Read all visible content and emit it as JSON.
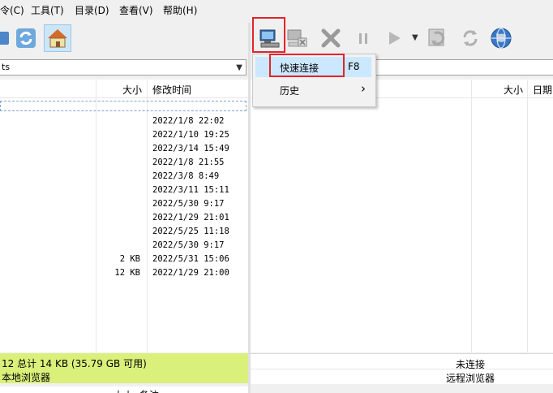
{
  "menu": {
    "items": [
      "令(C)",
      "工具(T)",
      "目录(D)",
      "查看(V)",
      "帮助(H)"
    ]
  },
  "left_pane": {
    "path_value": "ts",
    "columns": {
      "size": "大小",
      "modified": "修改时间"
    },
    "rows": [
      {
        "size": "",
        "modified": ""
      },
      {
        "size": "",
        "modified": "2022/1/8 22:02"
      },
      {
        "size": "",
        "modified": "2022/1/10 19:25"
      },
      {
        "size": "",
        "modified": "2022/3/14 15:49"
      },
      {
        "size": "",
        "modified": "2022/1/8 21:55"
      },
      {
        "size": "",
        "modified": "2022/3/8 8:49"
      },
      {
        "size": "",
        "modified": "2022/3/11 15:11"
      },
      {
        "size": "",
        "modified": "2022/5/30 9:17"
      },
      {
        "size": "",
        "modified": "2022/1/29 21:01"
      },
      {
        "size": "",
        "modified": "2022/5/25 11:18"
      },
      {
        "size": "",
        "modified": "2022/5/30 9:17"
      },
      {
        "size": "2 KB",
        "modified": "2022/5/31 15:06"
      },
      {
        "size": "12 KB",
        "modified": "2022/1/29 21:00"
      }
    ],
    "status": "12 总计 14 KB (35.79 GB 可用)",
    "label": "本地浏览器",
    "bottom_columns": {
      "size": "大小",
      "extra": "备注"
    }
  },
  "right_pane": {
    "columns": {
      "size": "大小",
      "date": "日期"
    },
    "status": "未连接",
    "label": "远程浏览器"
  },
  "dropdown": {
    "items": [
      {
        "label": "快速连接",
        "shortcut": "F8"
      },
      {
        "label": "历史",
        "submenu_arrow": "›"
      }
    ]
  },
  "colors": {
    "status_bg": "#d9f07a",
    "highlight": "#e3242b",
    "selection": "#cce8ff"
  }
}
